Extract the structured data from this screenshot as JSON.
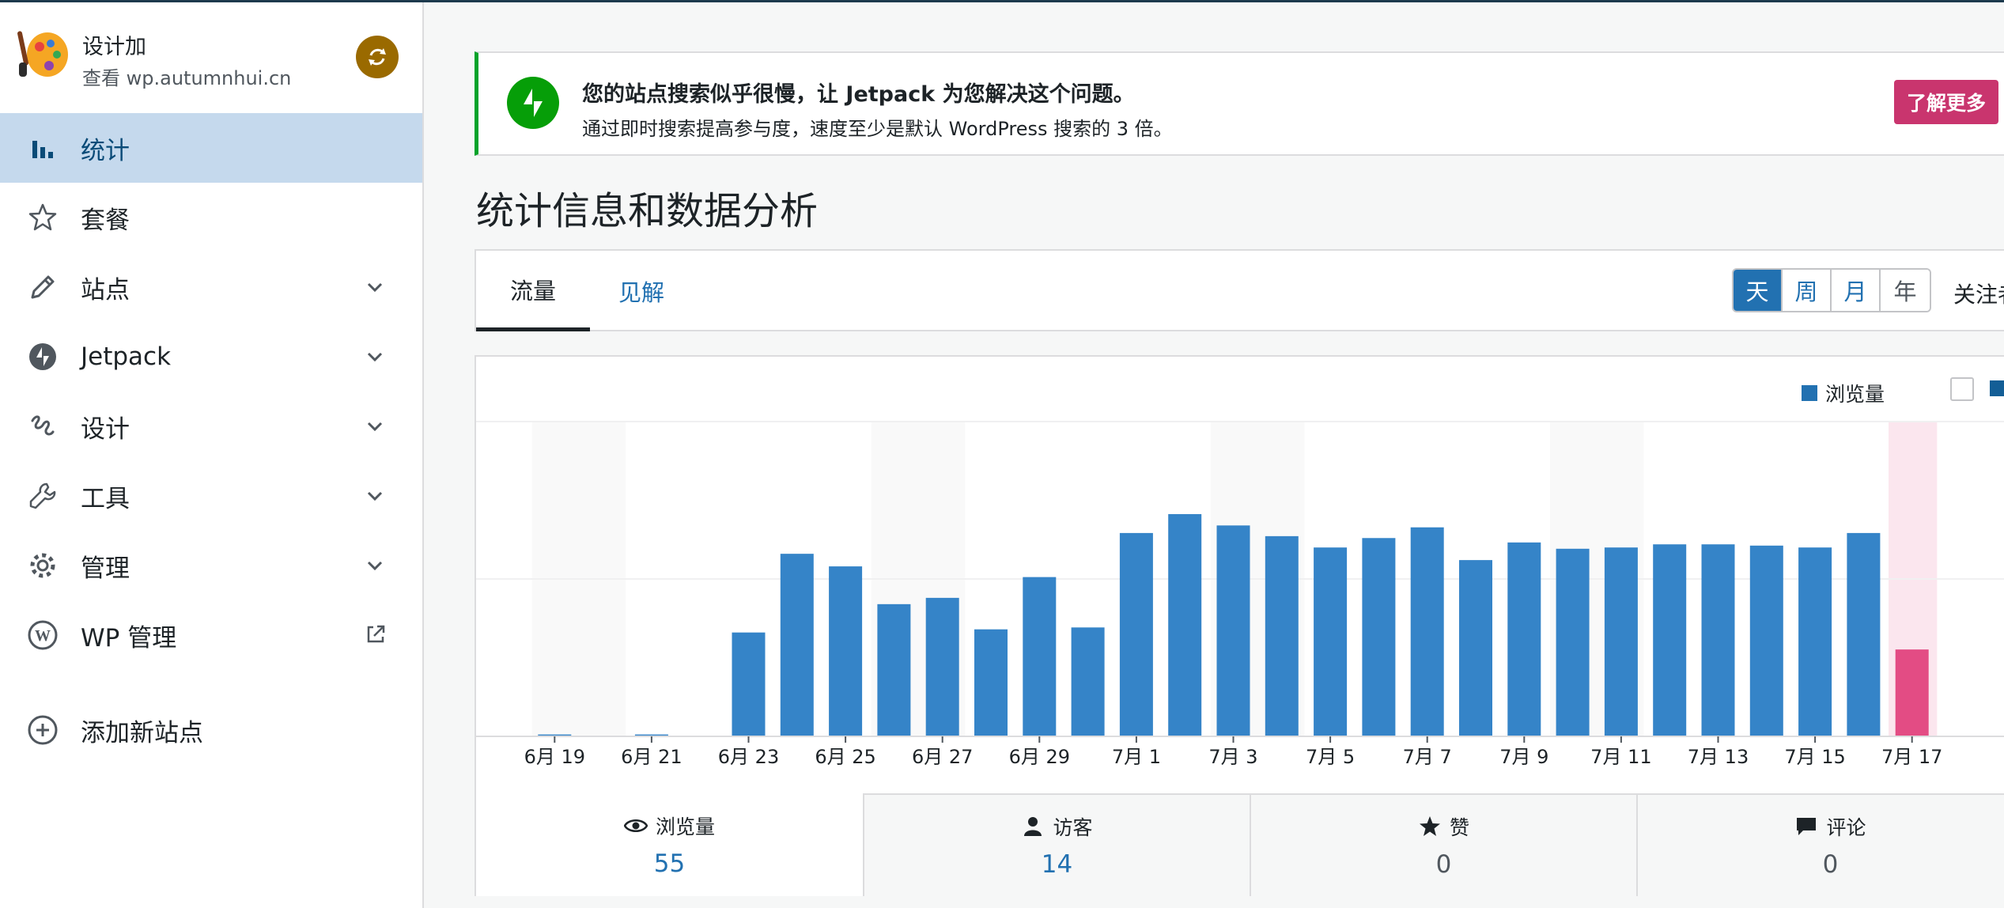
{
  "site": {
    "name": "设计加",
    "url": "查看 wp.autumnhui.cn"
  },
  "nav": {
    "items": [
      {
        "label": "统计",
        "icon": "bar-chart-icon",
        "active": true
      },
      {
        "label": "套餐",
        "icon": "star-icon"
      },
      {
        "label": "站点",
        "icon": "pencil-icon",
        "expandable": true
      },
      {
        "label": "Jetpack",
        "icon": "jetpack-icon",
        "expandable": true
      },
      {
        "label": "设计",
        "icon": "design-squiggle-icon",
        "expandable": true
      },
      {
        "label": "工具",
        "icon": "wrench-icon",
        "expandable": true
      },
      {
        "label": "管理",
        "icon": "gear-icon",
        "expandable": true
      },
      {
        "label": "WP 管理",
        "icon": "wordpress-icon",
        "external": true
      }
    ],
    "add_site": "添加新站点"
  },
  "banner": {
    "title": "您的站点搜索似乎很慢，让 Jetpack 为您解决这个问题。",
    "description": "通过即时搜索提高参与度，速度至少是默认 WordPress 搜索的 3 倍。",
    "button": "了解更多"
  },
  "page_title": "统计信息和数据分析",
  "tabs": {
    "traffic": "流量",
    "insights": "见解"
  },
  "periods": [
    "天",
    "周",
    "月",
    "年"
  ],
  "follow_label": "关注者",
  "legend": {
    "views": "浏览量"
  },
  "colors": {
    "bar": "#3584c8",
    "highlight_bar": "#e34c84",
    "highlight_band": "#fbe6ee",
    "weekend_band": "#f9f9f9",
    "accent": "#2271b1"
  },
  "chart_data": {
    "type": "bar",
    "categories": [
      "6月 18",
      "6月 19",
      "6月 20",
      "6月 21",
      "6月 22",
      "6月 23",
      "6月 24",
      "6月 25",
      "6月 26",
      "6月 27",
      "6月 28",
      "6月 29",
      "6月 30",
      "7月 1",
      "7月 2",
      "7月 3",
      "7月 4",
      "7月 5",
      "7月 6",
      "7月 7",
      "7月 8",
      "7月 9",
      "7月 10",
      "7月 11",
      "7月 12",
      "7月 13",
      "7月 14",
      "7月 15",
      "7月 16",
      "7月 17"
    ],
    "tick_labels": [
      "6月 19",
      "6月 21",
      "6月 23",
      "6月 25",
      "6月 27",
      "6月 29",
      "7月 1",
      "7月 3",
      "7月 5",
      "7月 7",
      "7月 9",
      "7月 11",
      "7月 13",
      "7月 15",
      "7月 17"
    ],
    "series": [
      {
        "name": "浏览量",
        "values": [
          0,
          0.3,
          0,
          0.3,
          0,
          16.5,
          29,
          27,
          21,
          22,
          17,
          25.3,
          17.3,
          32.3,
          35.3,
          33.5,
          31.8,
          30,
          31.5,
          33.2,
          28,
          30.8,
          29.8,
          30,
          30.5,
          30.5,
          30.3,
          30,
          32.3,
          13.8
        ]
      }
    ],
    "highlight_index": 29,
    "ylim": [
      0,
      50
    ],
    "grid": true
  },
  "stats": [
    {
      "label": "浏览量",
      "value": "55",
      "icon": "eye-icon",
      "active": true
    },
    {
      "label": "访客",
      "value": "14",
      "icon": "person-icon"
    },
    {
      "label": "赞",
      "value": "0",
      "icon": "star-filled-icon"
    },
    {
      "label": "评论",
      "value": "0",
      "icon": "comment-icon"
    }
  ]
}
